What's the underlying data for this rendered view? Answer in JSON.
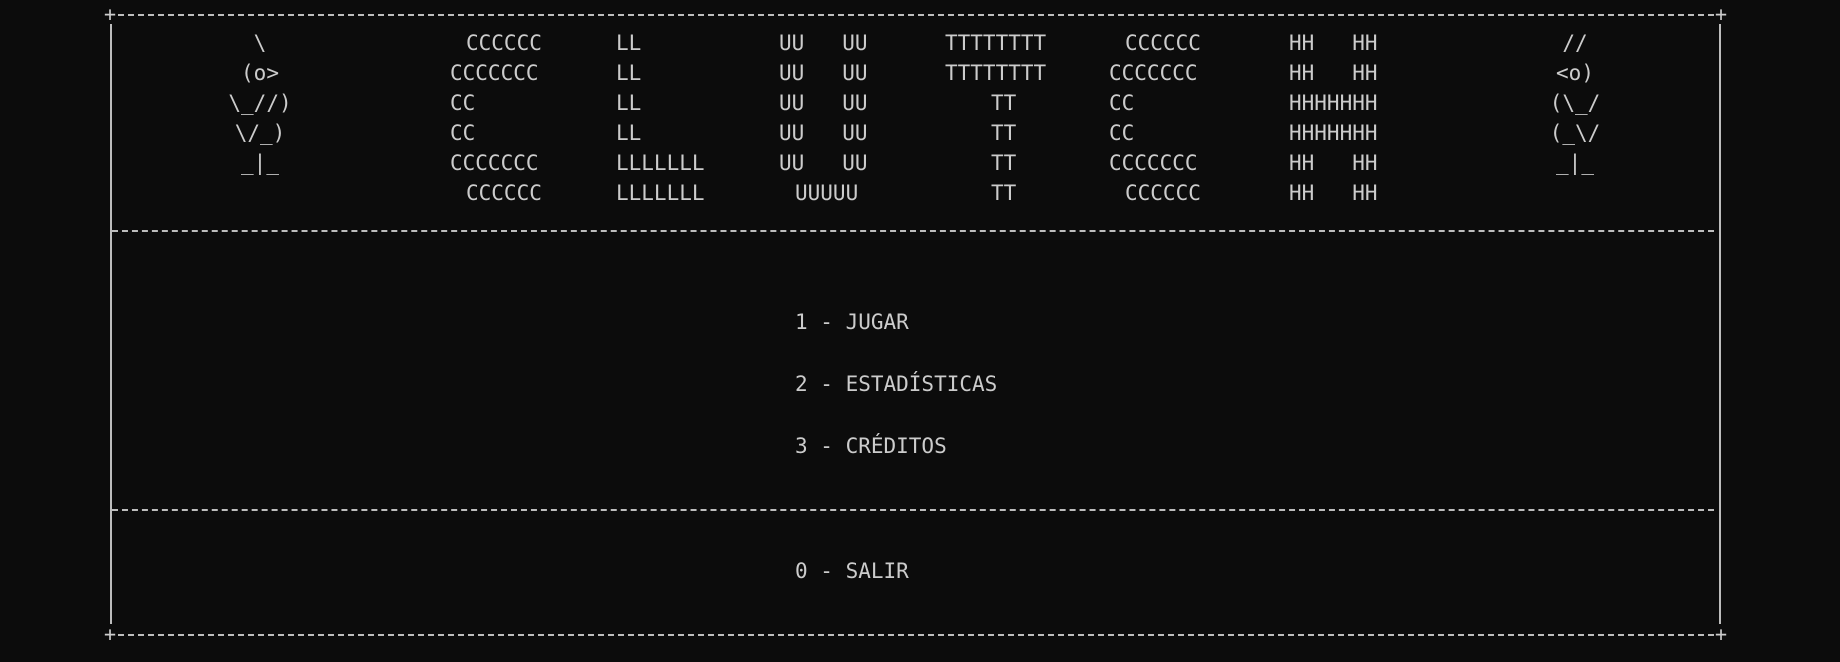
{
  "banner": {
    "left_mascot": [
      "\\",
      "(o>",
      "\\_//)",
      "\\/_)",
      "_|_"
    ],
    "right_mascot": [
      "//",
      "<o)",
      "(\\_/",
      "(_\\/",
      "_|_"
    ],
    "letters": {
      "C1": [
        "CCCCCC",
        "CCCCCCC",
        "CC",
        "CC",
        "CCCCCCC",
        "CCCCCC"
      ],
      "L": [
        "LL",
        "LL",
        "LL",
        "LL",
        "LLLLLLL",
        "LLLLLLL"
      ],
      "U": [
        "UU   UU",
        "UU   UU",
        "UU   UU",
        "UU   UU",
        "UU   UU",
        "UUUUU"
      ],
      "T": [
        "TTTTTTTT",
        "TTTTTTTT",
        "TT",
        "TT",
        "TT",
        "TT"
      ],
      "C2": [
        "CCCCCC",
        "CCCCCCC",
        "CC",
        "CC",
        "CCCCCCC",
        "CCCCCC"
      ],
      "H": [
        "HH   HH",
        "HH   HH",
        "HHHHHHH",
        "HHHHHHH",
        "HH   HH",
        "HH   HH"
      ]
    }
  },
  "menu": {
    "items": [
      "1 - JUGAR",
      "2 - ESTADÍSTICAS",
      "3 - CRÉDITOS"
    ],
    "exit": "0 - SALIR"
  }
}
